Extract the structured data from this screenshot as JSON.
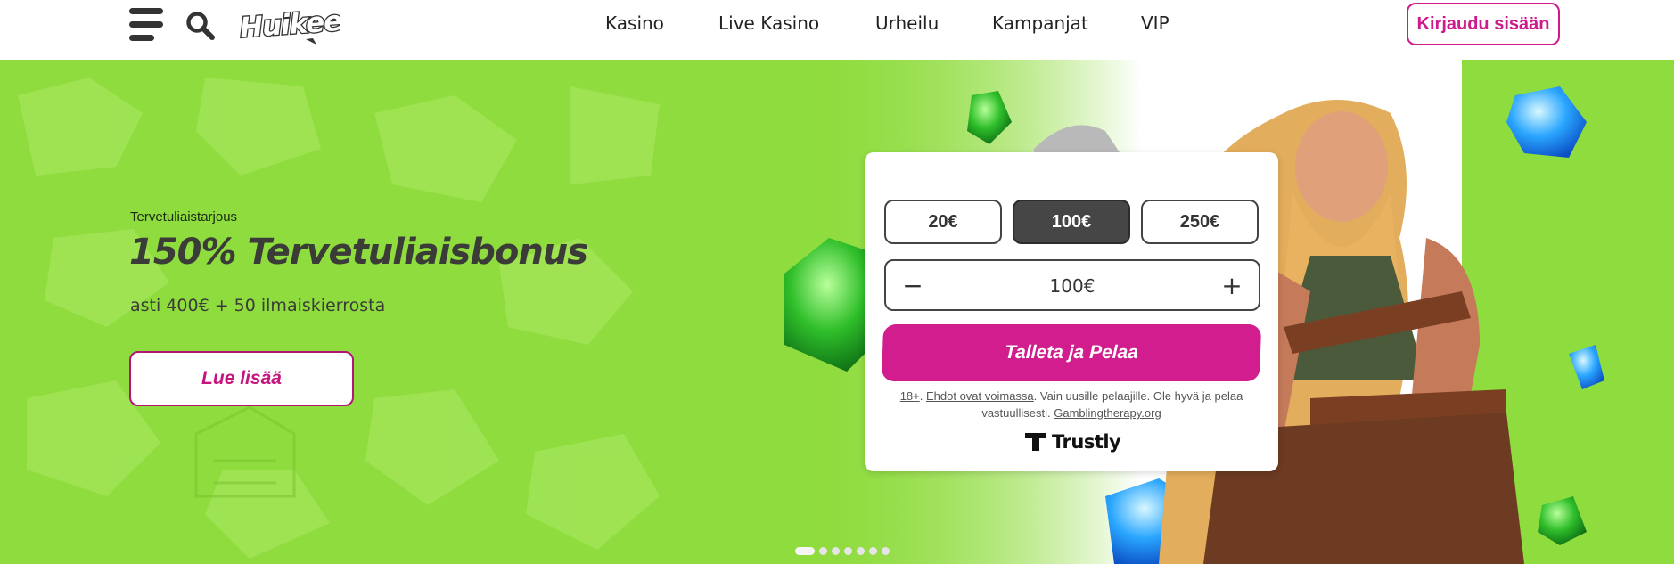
{
  "brand": {
    "logo_text": "Huikee",
    "accent_color": "#cf1a8c",
    "hero_green": "#8fdc3e"
  },
  "header": {
    "menu_icon": "hamburger-menu-icon",
    "search_icon": "search-icon",
    "nav": [
      {
        "label": "Kasino"
      },
      {
        "label": "Live Kasino"
      },
      {
        "label": "Urheilu"
      },
      {
        "label": "Kampanjat"
      },
      {
        "label": "VIP"
      }
    ],
    "login_label": "Kirjaudu sisään"
  },
  "hero": {
    "eyebrow": "Tervetuliaistarjous",
    "headline": "150% Tervetuliaisbonus",
    "subheadline": "asti 400€ + 50 ilmaiskierrosta",
    "more_label": "Lue lisää"
  },
  "deposit": {
    "amounts": [
      {
        "label": "20€",
        "selected": false
      },
      {
        "label": "100€",
        "selected": true
      },
      {
        "label": "250€",
        "selected": false
      }
    ],
    "minus_label": "−",
    "plus_label": "+",
    "current_value": "100€",
    "cta_label": "Talleta ja Pelaa",
    "terms": {
      "age": "18+",
      "sep1": ". ",
      "terms_link": "Ehdot ovat voimassa",
      "text": ". Vain uusille pelaajille. Ole hyvä ja pelaa vastuullisesti. ",
      "help_link": "Gamblingtherapy.org"
    },
    "payment_provider": "Trustly"
  },
  "carousel": {
    "slide_count": 7,
    "active_index": 0
  }
}
